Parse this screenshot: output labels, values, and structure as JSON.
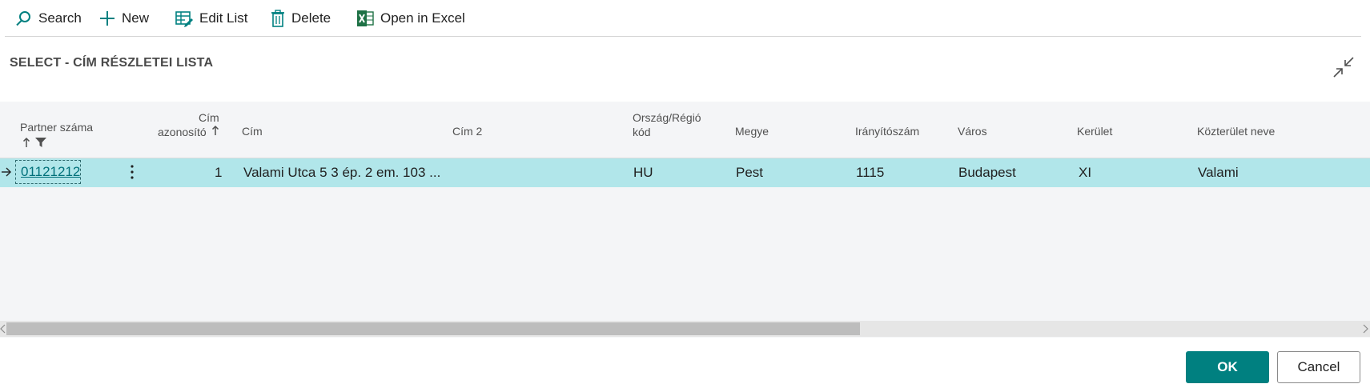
{
  "toolbar": {
    "search_label": "Search",
    "new_label": "New",
    "edit_list_label": "Edit List",
    "delete_label": "Delete",
    "open_excel_label": "Open in Excel"
  },
  "page": {
    "title": "SELECT - CÍM RÉSZLETEI LISTA"
  },
  "table": {
    "columns": {
      "partner": "Partner száma",
      "cim_azonosito_1": "Cím",
      "cim_azonosito_2": "azonosító",
      "cim": "Cím",
      "cim2": "Cím 2",
      "orszag_1": "Ország/Régió",
      "orszag_2": "kód",
      "megye": "Megye",
      "iranyitoszam": "Irányítószám",
      "varos": "Város",
      "kerulet": "Kerület",
      "kozterulet": "Közterület neve"
    },
    "rows": [
      {
        "partner": "01121212",
        "cim_azonosito": "1",
        "cim": "Valami  Utca 5 3 ép. 2 em. 103 ...",
        "cim2": "",
        "orszag": "HU",
        "megye": "Pest",
        "iranyitoszam": "1115",
        "varos": "Budapest",
        "kerulet": "XI",
        "kozterulet": "Valami"
      }
    ]
  },
  "footer": {
    "ok_label": "OK",
    "cancel_label": "Cancel"
  },
  "colors": {
    "accent": "#008080",
    "row_selected": "#b1e6ea",
    "link": "#00707a"
  }
}
